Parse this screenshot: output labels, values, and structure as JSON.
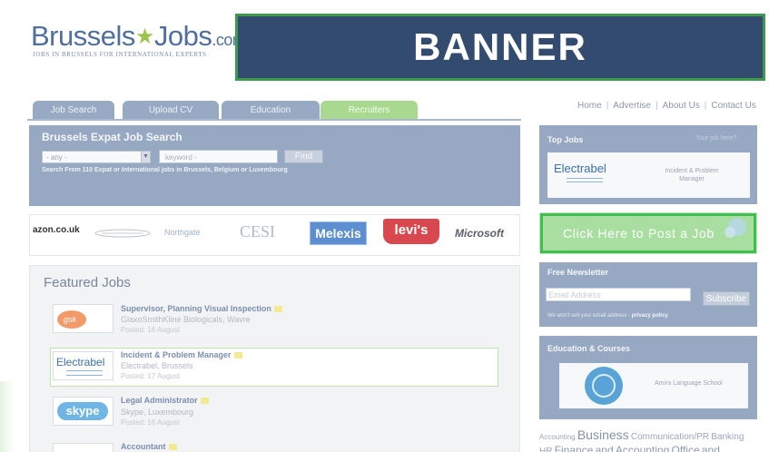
{
  "logo": {
    "brand_left": "Brussels",
    "brand_right": "Jobs",
    "domain": ".com",
    "tagline": "JOBS IN BRUSSELS FOR INTERNATIONAL EXPERTS"
  },
  "banner": {
    "label": "BANNER"
  },
  "tabs": [
    {
      "label": "Job Search"
    },
    {
      "label": "Upload CV"
    },
    {
      "label": "Education"
    },
    {
      "label": "Recruiters"
    }
  ],
  "top_links": [
    "Home",
    "Advertise",
    "About Us",
    "Contact Us"
  ],
  "search": {
    "title": "Brussels Expat Job Search",
    "select_value": "- any -",
    "keyword_placeholder": "keyword -",
    "find_label": "Find",
    "subtitle": "Search From 110 Expat or International jobs in Brussels, Belgium or Luxembourg"
  },
  "brand_logos": [
    "azon.co.uk",
    "Northgate",
    "CESI",
    "Melexis",
    "levi's",
    "Microsoft"
  ],
  "featured": {
    "title": "Featured Jobs",
    "jobs": [
      {
        "title": "Supervisor, Planning Visual Inspection",
        "company": "GlaxoSmithKline Biologicals, Wavre",
        "posted": "Posted: 16 August",
        "logo": "gsk"
      },
      {
        "title": "Incident & Problem Manager",
        "company": "Electrabel, Brussels",
        "posted": "Posted: 17 August",
        "logo": "Electrabel"
      },
      {
        "title": "Legal Administrator",
        "company": "Skype, Luxembourg",
        "posted": "Posted: 16 August",
        "logo": "skype"
      },
      {
        "title": "Accountant",
        "company": "",
        "posted": "",
        "logo": ""
      }
    ]
  },
  "sidebar": {
    "top_jobs": {
      "title": "Top Jobs",
      "link": "Your job here?",
      "logo": "Electrabel",
      "job": "Incident & Problem Manager"
    },
    "post_job": {
      "label": "Click Here to Post a Job"
    },
    "newsletter": {
      "title": "Free Newsletter",
      "email_placeholder": "Email Address",
      "subscribe_label": "Subscribe",
      "privacy_text": "We won't sell your email address - ",
      "privacy_link": "privacy policy"
    },
    "education": {
      "title": "Education & Courses",
      "school": "Amira Language School"
    },
    "tag_cloud": [
      "Accounting",
      "Business",
      "Communication/PR",
      "Banking",
      "HR",
      "Finance",
      "and",
      "Accounting",
      "Office",
      "and"
    ]
  },
  "colors": {
    "banner_bg": "#334b6e",
    "banner_border": "#3c9a4c",
    "panel": "#97a8c2",
    "accent_green": "#3fbd4f"
  }
}
